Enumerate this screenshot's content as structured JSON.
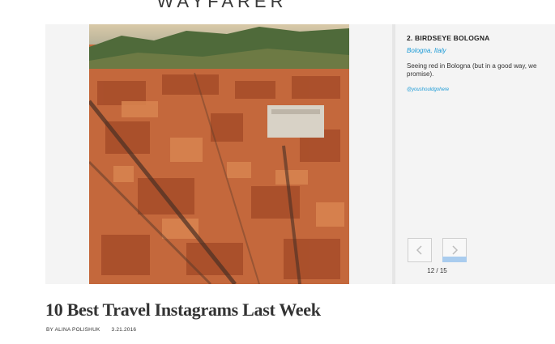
{
  "site": {
    "name": "WAYFARER"
  },
  "slide": {
    "title": "2. BIRDSEYE BOLOGNA",
    "city": "Bologna",
    "separator": ",",
    "country": "Italy",
    "caption": "Seeing red in Bologna (but in a good way, we promise).",
    "handle": "@youshouldgohere"
  },
  "pager": {
    "counter": "12 / 15",
    "progress": 0.8
  },
  "article": {
    "title": "10 Best Travel Instagrams Last Week",
    "byline": "BY ALINA POLISHUK",
    "date": "3.21.2016"
  },
  "colors": {
    "accent": "#1a9ad6",
    "progress_bar": "#a9ccee",
    "rooftops": "#c96a3a"
  },
  "icons": [
    "chevron-left-icon",
    "chevron-right-icon"
  ]
}
